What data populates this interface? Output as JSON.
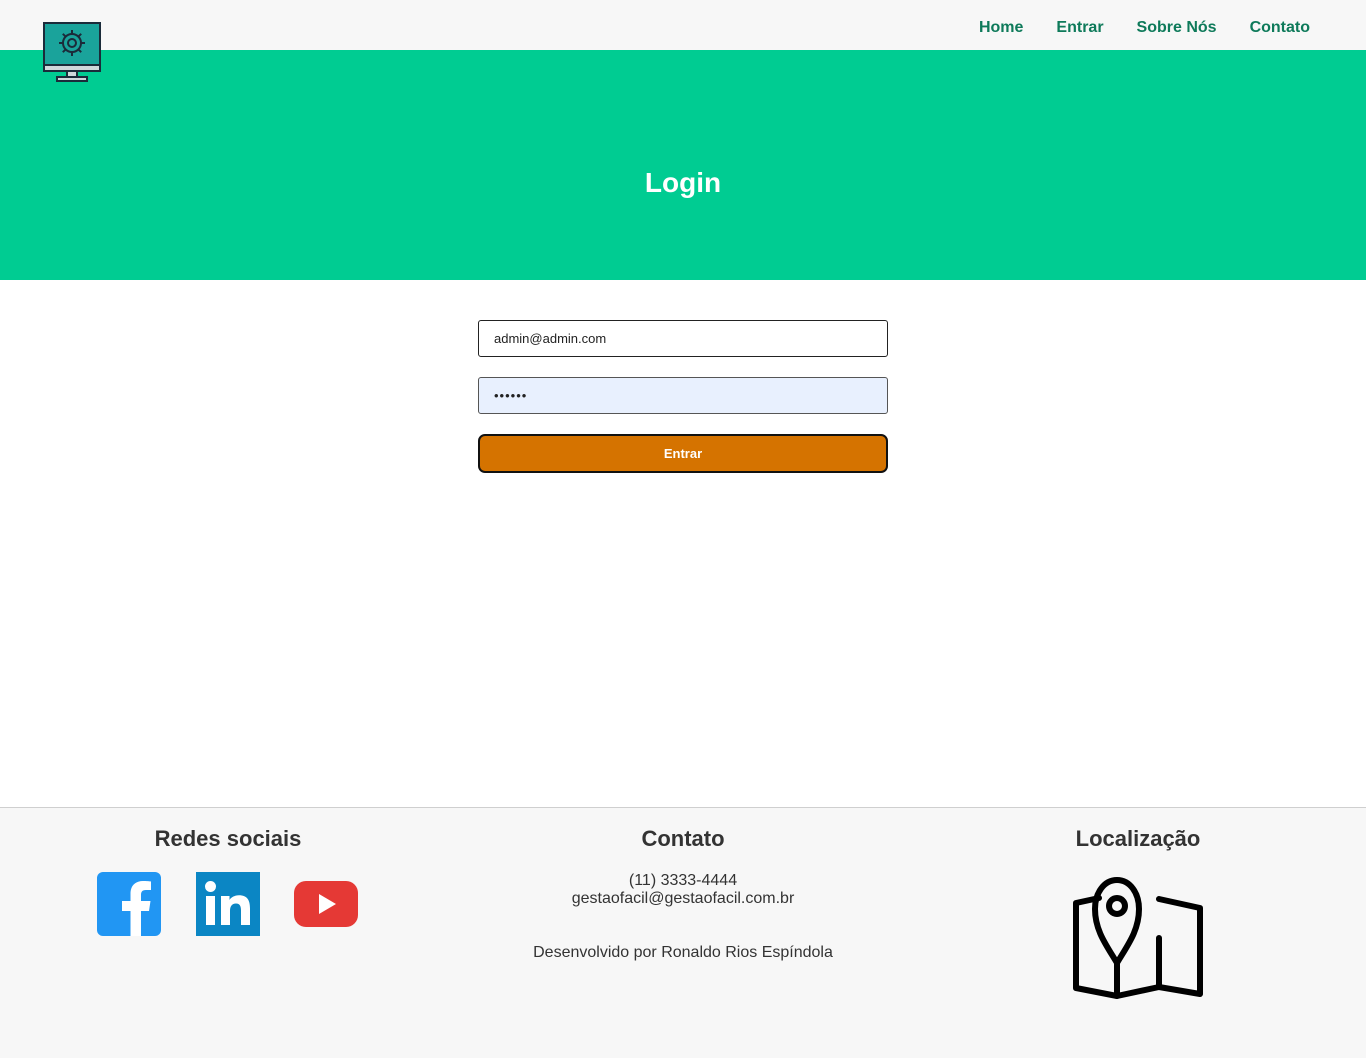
{
  "nav": {
    "items": [
      {
        "label": "Home"
      },
      {
        "label": "Entrar"
      },
      {
        "label": "Sobre Nós"
      },
      {
        "label": "Contato"
      }
    ]
  },
  "hero": {
    "title": "Login"
  },
  "form": {
    "email_value": "admin@admin.com",
    "password_value": "123456",
    "submit_label": "Entrar"
  },
  "footer": {
    "social_title": "Redes sociais",
    "contact_title": "Contato",
    "phone": "(11) 3333-4444",
    "email": "gestaofacil@gestaofacil.com.br",
    "credit": "Desenvolvido por Ronaldo Rios Espíndola",
    "location_title": "Localização"
  },
  "colors": {
    "accent_green": "#00cc92",
    "nav_text": "#0e7a5a",
    "button_orange": "#d57300"
  },
  "icons": [
    "monitor-gear-icon",
    "facebook-icon",
    "linkedin-icon",
    "youtube-icon",
    "map-pin-icon"
  ]
}
